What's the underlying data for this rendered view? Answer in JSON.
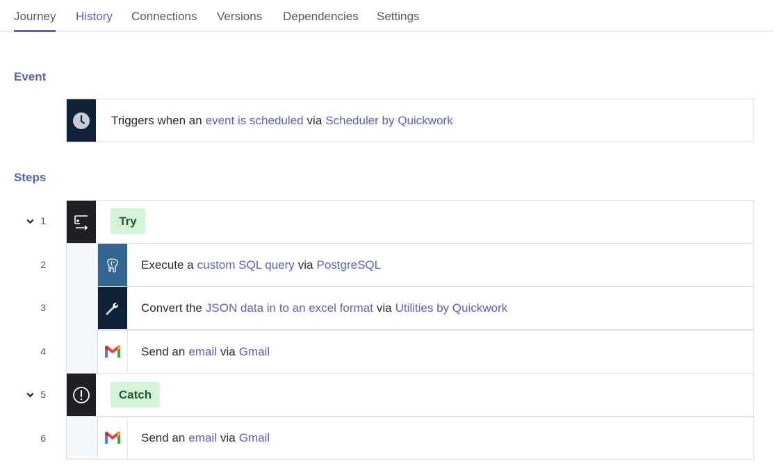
{
  "tabs": [
    {
      "label": "Journey"
    },
    {
      "label": "History"
    },
    {
      "label": "Connections"
    },
    {
      "label": "Versions"
    },
    {
      "label": "Dependencies"
    },
    {
      "label": "Settings"
    }
  ],
  "event": {
    "title": "Event",
    "trigger": {
      "prefix": "Triggers when an",
      "action": "event is scheduled",
      "via": "via",
      "app": "Scheduler by Quickwork"
    }
  },
  "steps": {
    "title": "Steps",
    "items": [
      {
        "number": "1",
        "badge": "Try"
      },
      {
        "number": "2",
        "prefix": "Execute a",
        "action": "custom SQL query",
        "via": "via",
        "app": "PostgreSQL"
      },
      {
        "number": "3",
        "prefix": "Convert the",
        "action": "JSON data in to an excel format",
        "via": "via",
        "app": "Utilities by Quickwork"
      },
      {
        "number": "4",
        "prefix": "Send an",
        "action": "email",
        "via": "via",
        "app": "Gmail"
      },
      {
        "number": "5",
        "badge": "Catch"
      },
      {
        "number": "6",
        "prefix": "Send an",
        "action": "email",
        "via": "via",
        "app": "Gmail"
      }
    ]
  },
  "colors": {
    "accent": "#5a5fc7",
    "dark_icon_bg": "#0f2238",
    "postgres_bg": "#336791",
    "badge_bg": "#d5f3d6",
    "badge_text": "#1f5a33"
  },
  "icons": {
    "event": "clock-icon",
    "try": "try-block-icon",
    "postgres": "postgresql-elephant-icon",
    "utilities": "wrench-icon",
    "gmail": "gmail-icon",
    "catch": "exclamation-circle-icon",
    "collapse": "chevron-down-icon"
  }
}
